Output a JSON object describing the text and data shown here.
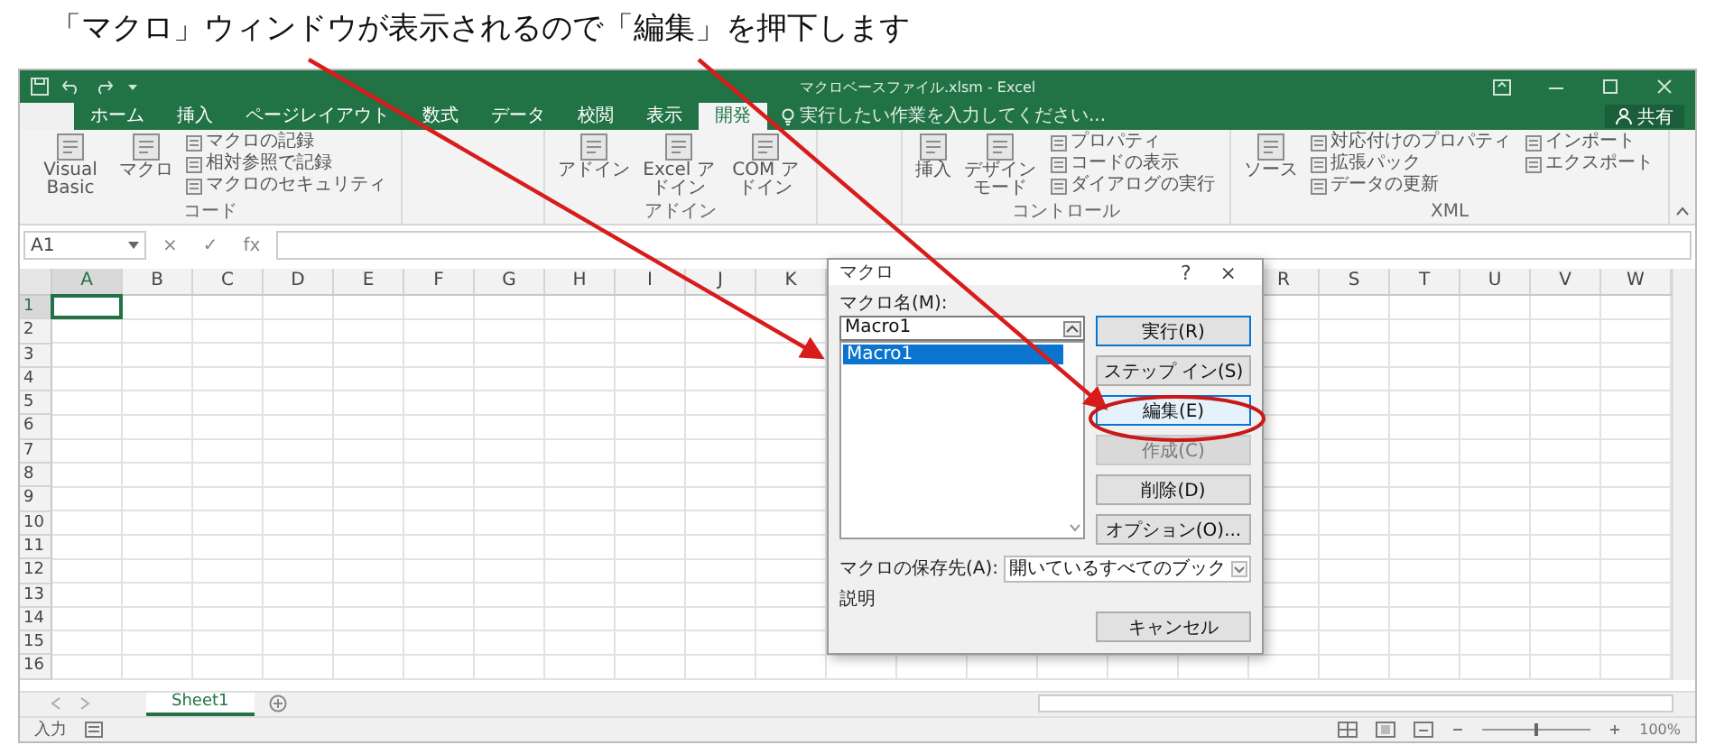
{
  "caption": "「マクロ」ウィンドウが表示されるので「編集」を押下します",
  "window": {
    "title": "マクロベースファイル.xlsm - Excel",
    "share": "共有"
  },
  "tabs": [
    {
      "label": "ホーム",
      "selected": false
    },
    {
      "label": "挿入",
      "selected": false
    },
    {
      "label": "ページレイアウト",
      "selected": false
    },
    {
      "label": "数式",
      "selected": false
    },
    {
      "label": "データ",
      "selected": false
    },
    {
      "label": "校閲",
      "selected": false
    },
    {
      "label": "表示",
      "selected": false
    },
    {
      "label": "開発",
      "selected": true
    }
  ],
  "tell_me": {
    "placeholder": "実行したい作業を入力してください..."
  },
  "ribbon": [
    {
      "label": "コード",
      "items": [
        {
          "kind": "large",
          "label": "Visual Basic"
        },
        {
          "kind": "large",
          "label": "マクロ"
        },
        {
          "kind": "small",
          "label": "マクロの記録"
        },
        {
          "kind": "small",
          "label": "相対参照で記録"
        },
        {
          "kind": "small",
          "label": "マクロのセキュリティ"
        }
      ]
    },
    {
      "label": "アドイン",
      "items": [
        {
          "kind": "large",
          "label": "アドイン"
        },
        {
          "kind": "large",
          "label": "Excel アドイン"
        },
        {
          "kind": "large",
          "label": "COM アドイン"
        }
      ]
    },
    {
      "label": "コントロール",
      "items": [
        {
          "kind": "large",
          "label": "挿入"
        },
        {
          "kind": "large",
          "label": "デザインモード"
        },
        {
          "kind": "small",
          "label": "プロパティ"
        },
        {
          "kind": "small",
          "label": "コードの表示"
        },
        {
          "kind": "small",
          "label": "ダイアログの実行"
        }
      ]
    },
    {
      "label": "XML",
      "items": [
        {
          "kind": "large",
          "label": "ソース"
        },
        {
          "kind": "small",
          "label": "対応付けのプロパティ"
        },
        {
          "kind": "small",
          "label": "拡張パック"
        },
        {
          "kind": "small",
          "label": "データの更新"
        },
        {
          "kind": "small",
          "label": "インポート"
        },
        {
          "kind": "small",
          "label": "エクスポート"
        }
      ]
    }
  ],
  "formula_bar": {
    "name_box": "A1",
    "buttons": [
      "×",
      "✓",
      "fx"
    ]
  },
  "sheet": {
    "columns_left": [
      {
        "label": "A",
        "selected": true
      },
      {
        "label": "B",
        "selected": false
      },
      {
        "label": "C",
        "selected": false
      },
      {
        "label": "D",
        "selected": false
      },
      {
        "label": "E",
        "selected": false
      },
      {
        "label": "F",
        "selected": false
      },
      {
        "label": "G",
        "selected": false
      },
      {
        "label": "H",
        "selected": false
      },
      {
        "label": "I",
        "selected": false
      },
      {
        "label": "J",
        "selected": false
      },
      {
        "label": "K",
        "selected": false
      }
    ],
    "columns_right": [
      {
        "label": "R",
        "selected": false
      },
      {
        "label": "S",
        "selected": false
      },
      {
        "label": "T",
        "selected": false
      },
      {
        "label": "U",
        "selected": false
      },
      {
        "label": "V",
        "selected": false
      },
      {
        "label": "W",
        "selected": false
      }
    ],
    "rows": [
      {
        "label": "1",
        "selected": true
      },
      {
        "label": "2",
        "selected": false
      },
      {
        "label": "3",
        "selected": false
      },
      {
        "label": "4",
        "selected": false
      },
      {
        "label": "5",
        "selected": false
      },
      {
        "label": "6",
        "selected": false
      },
      {
        "label": "7",
        "selected": false
      },
      {
        "label": "8",
        "selected": false
      },
      {
        "label": "9",
        "selected": false
      },
      {
        "label": "10",
        "selected": false
      },
      {
        "label": "11",
        "selected": false
      },
      {
        "label": "12",
        "selected": false
      },
      {
        "label": "13",
        "selected": false
      },
      {
        "label": "14",
        "selected": false
      },
      {
        "label": "15",
        "selected": false
      },
      {
        "label": "16",
        "selected": false
      }
    ]
  },
  "sheet_tabs": [
    {
      "label": "Sheet1",
      "selected": true
    }
  ],
  "status_bar": {
    "mode": "入力",
    "zoom": {
      "level": 0.5,
      "reading": "100%"
    }
  },
  "dialog": {
    "title": "マクロ",
    "help": "?",
    "close": "×",
    "name_label": "マクロ名(M):",
    "name_value": "Macro1",
    "macros": [
      {
        "label": "Macro1",
        "selected": true
      }
    ],
    "buttons": [
      {
        "label": "実行(R)",
        "default": true,
        "highlighted": false,
        "disabled": false
      },
      {
        "label": "ステップ イン(S)",
        "default": false,
        "highlighted": false,
        "disabled": false
      },
      {
        "label": "編集(E)",
        "default": false,
        "highlighted": true,
        "disabled": false
      },
      {
        "label": "作成(C)",
        "default": false,
        "highlighted": false,
        "disabled": true
      },
      {
        "label": "削除(D)",
        "default": false,
        "highlighted": false,
        "disabled": false
      },
      {
        "label": "オプション(O)...",
        "default": false,
        "highlighted": false,
        "disabled": false
      }
    ],
    "store_label": "マクロの保存先(A):",
    "store_value": "開いているすべてのブック",
    "description_label": "説明",
    "cancel": "キャンセル"
  }
}
